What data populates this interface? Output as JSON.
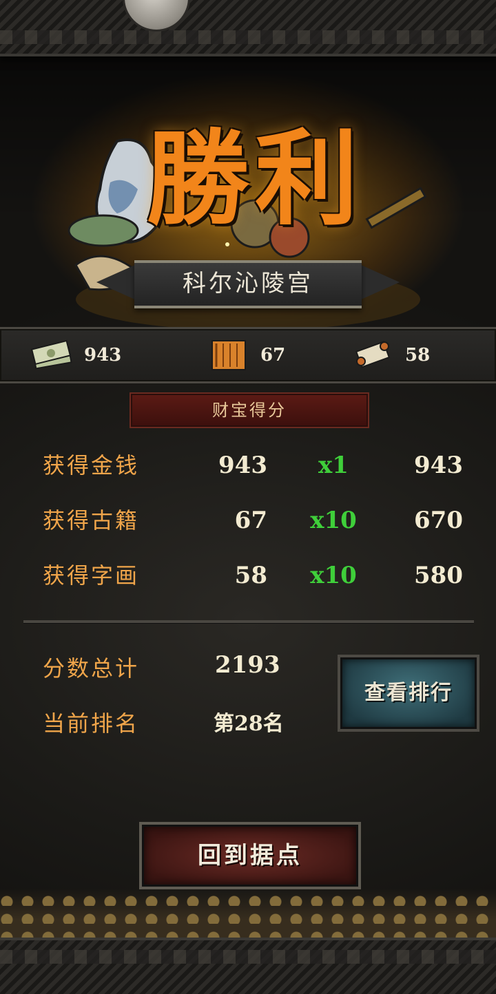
{
  "title": "勝利",
  "location": "科尔沁陵宫",
  "resources": [
    {
      "icon": "money-stack-icon",
      "value": "943"
    },
    {
      "icon": "ancient-book-icon",
      "value": "67"
    },
    {
      "icon": "scroll-painting-icon",
      "value": "58"
    }
  ],
  "section_title": "财宝得分",
  "rows": [
    {
      "label": "获得金钱",
      "count": "943",
      "multiplier": "x1",
      "total": "943"
    },
    {
      "label": "获得古籍",
      "count": "67",
      "multiplier": "x10",
      "total": "670"
    },
    {
      "label": "获得字画",
      "count": "58",
      "multiplier": "x10",
      "total": "580"
    }
  ],
  "summary": {
    "total_label": "分数总计",
    "total_value": "2193",
    "rank_label": "当前排名",
    "rank_value": "第28名"
  },
  "buttons": {
    "view_rank": "查看排行",
    "return_home": "回到据点"
  },
  "colors": {
    "title": "#f2851a",
    "label": "#f0a54a",
    "multiplier": "#3fcf3a",
    "value": "#f3ebd1"
  }
}
